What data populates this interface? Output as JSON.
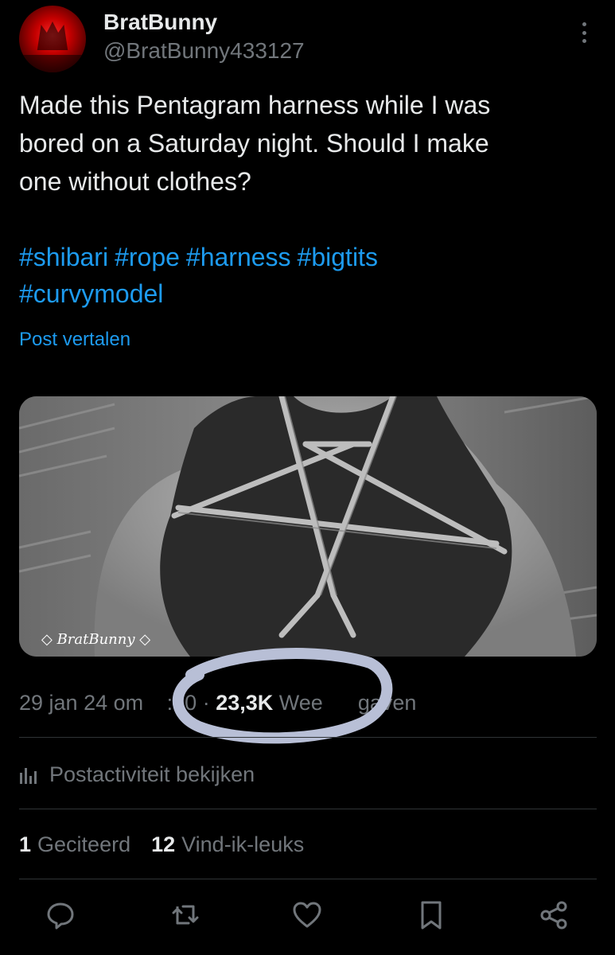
{
  "author": {
    "display_name": "BratBunny",
    "handle": "@BratBunny433127"
  },
  "post": {
    "text_lines": [
      "Made this Pentagram harness while I was",
      "bored on a Saturday night. Should I make",
      "one without clothes?"
    ],
    "hashtags": [
      "#shibari",
      "#rope",
      "#harness",
      "#bigtits",
      "#curvymodel"
    ],
    "translate_label": "Post vertalen",
    "media_watermark": "◇ BratBunny ◇"
  },
  "meta": {
    "date_prefix": "29 jan 24 om",
    "time_visible": ":30",
    "separator": "·",
    "views_count": "23,3K",
    "views_label_start": "Wee",
    "views_label_end": "gaven"
  },
  "activity": {
    "label": "Postactiviteit bekijken",
    "icon": "bar-chart-icon"
  },
  "stats": {
    "quotes_count": "1",
    "quotes_label": "Geciteerd",
    "likes_count": "12",
    "likes_label": "Vind-ik-leuks"
  },
  "actions": {
    "reply_icon": "reply-icon",
    "repost_icon": "repost-icon",
    "like_icon": "heart-icon",
    "bookmark_icon": "bookmark-icon",
    "share_icon": "share-icon"
  },
  "colors": {
    "background": "#000000",
    "text": "#e7e9ea",
    "muted": "#71767b",
    "link": "#1d9bf0",
    "divider": "#2f3336",
    "annotation_circle": "#b8bfd6"
  }
}
